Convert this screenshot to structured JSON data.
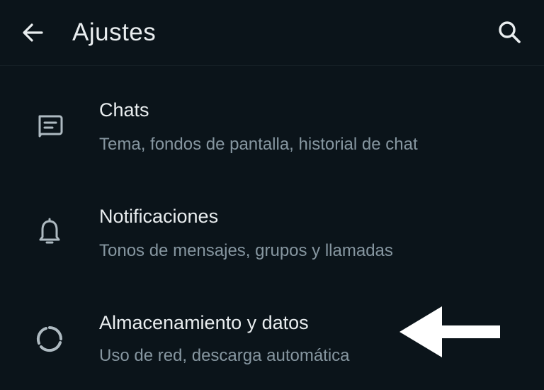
{
  "header": {
    "title": "Ajustes",
    "back_icon": "arrow-left-icon",
    "search_icon": "search-icon"
  },
  "settings": [
    {
      "icon": "chat-icon",
      "title": "Chats",
      "subtitle": "Tema, fondos de pantalla, historial de chat"
    },
    {
      "icon": "bell-icon",
      "title": "Notificaciones",
      "subtitle": "Tonos de mensajes, grupos y llamadas"
    },
    {
      "icon": "storage-circle-icon",
      "title": "Almacenamiento y datos",
      "subtitle": "Uso de red, descarga automática"
    }
  ],
  "colors": {
    "background": "#0b141a",
    "primary_text": "#e9edef",
    "secondary_text": "#8696a0",
    "icon": "#aebac1",
    "annotation_arrow": "#ffffff"
  }
}
